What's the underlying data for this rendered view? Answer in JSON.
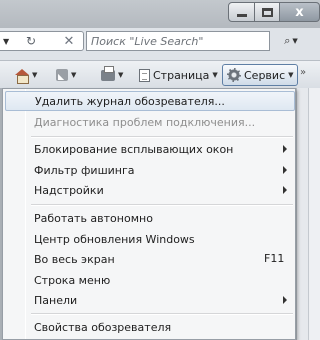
{
  "window": {
    "minimize_icon": "minimize-icon",
    "maximize_icon": "maximize-icon",
    "close_icon": "close-icon",
    "close_glyph": "x"
  },
  "search": {
    "placeholder": "Поиск \"Live Search\"",
    "icon": "magnifier-icon"
  },
  "command_bar": {
    "page_label": "Страница",
    "tools_label": "Сервис",
    "chevron": "»"
  },
  "menu": {
    "items": [
      {
        "label": "Удалить журнал обозревателя...",
        "disabled": false,
        "highlighted": true
      },
      {
        "label": "Диагностика проблем подключения...",
        "disabled": true
      },
      {
        "label": "Блокирование всплывающих окон",
        "submenu": true
      },
      {
        "label": "Фильтр фишинга",
        "submenu": true
      },
      {
        "label": "Надстройки",
        "submenu": true
      },
      {
        "label": "Работать автономно"
      },
      {
        "label": "Центр обновления Windows"
      },
      {
        "label": "Во весь экран",
        "shortcut": "F11"
      },
      {
        "label": "Строка меню"
      },
      {
        "label": "Панели",
        "submenu": true
      },
      {
        "label": "Свойства обозревателя"
      }
    ]
  }
}
